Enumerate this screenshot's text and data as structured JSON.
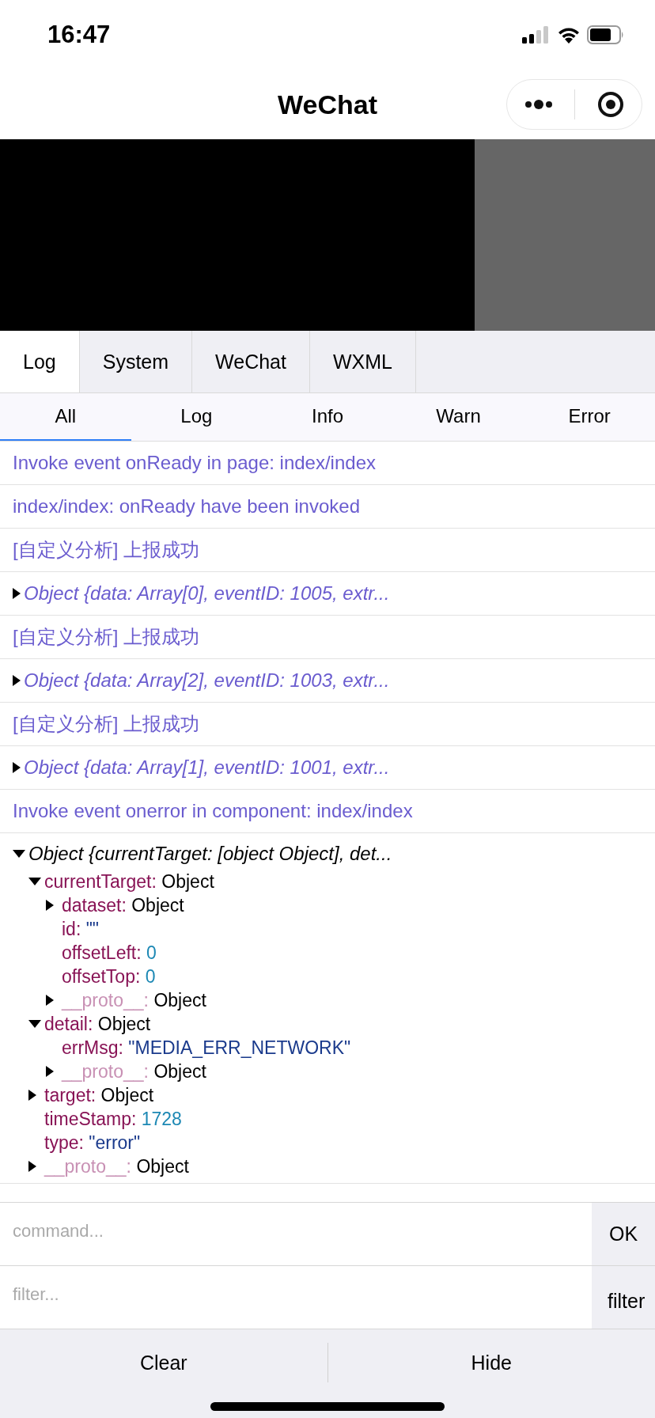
{
  "status_bar": {
    "time": "16:47"
  },
  "nav_bar": {
    "title": "WeChat"
  },
  "tabs": [
    {
      "label": "Log",
      "selected": true
    },
    {
      "label": "System",
      "selected": false
    },
    {
      "label": "WeChat",
      "selected": false
    },
    {
      "label": "WXML",
      "selected": false
    }
  ],
  "filters": [
    {
      "label": "All",
      "selected": true
    },
    {
      "label": "Log",
      "selected": false
    },
    {
      "label": "Info",
      "selected": false
    },
    {
      "label": "Warn",
      "selected": false
    },
    {
      "label": "Error",
      "selected": false
    }
  ],
  "log_entries": [
    {
      "kind": "text",
      "text": "Invoke event onReady in page: index/index"
    },
    {
      "kind": "text",
      "text": "index/index: onReady have been invoked"
    },
    {
      "kind": "text",
      "text": "[自定义分析] 上报成功"
    },
    {
      "kind": "object",
      "expanded": false,
      "text": "Object {data: Array[0], eventID: 1005, extr..."
    },
    {
      "kind": "text",
      "text": "[自定义分析] 上报成功"
    },
    {
      "kind": "object",
      "expanded": false,
      "text": "Object {data: Array[2], eventID: 1003, extr..."
    },
    {
      "kind": "text",
      "text": "[自定义分析] 上报成功"
    },
    {
      "kind": "object",
      "expanded": false,
      "text": "Object {data: Array[1], eventID: 1001, extr..."
    },
    {
      "kind": "text",
      "text": "Invoke event onerror in component: index/index"
    },
    {
      "kind": "object",
      "expanded": true,
      "text": "Object {currentTarget: [object Object], det...",
      "children": [
        {
          "key": "currentTarget:",
          "kind": "object",
          "value": "Object",
          "expanded": true,
          "children": [
            {
              "key": "dataset:",
              "kind": "object",
              "value": "Object",
              "expanded": false
            },
            {
              "key": "id:",
              "kind": "string",
              "value": "\"\""
            },
            {
              "key": "offsetLeft:",
              "kind": "number",
              "value": "0"
            },
            {
              "key": "offsetTop:",
              "kind": "number",
              "value": "0"
            },
            {
              "key": "__proto__:",
              "kind": "proto",
              "value": "Object",
              "expanded": false
            }
          ]
        },
        {
          "key": "detail:",
          "kind": "object",
          "value": "Object",
          "expanded": true,
          "children": [
            {
              "key": "errMsg:",
              "kind": "string",
              "value": "\"MEDIA_ERR_NETWORK\""
            },
            {
              "key": "__proto__:",
              "kind": "proto",
              "value": "Object",
              "expanded": false
            }
          ]
        },
        {
          "key": "target:",
          "kind": "object",
          "value": "Object",
          "expanded": false
        },
        {
          "key": "timeStamp:",
          "kind": "number",
          "value": "1728"
        },
        {
          "key": "type:",
          "kind": "string",
          "value": "\"error\""
        },
        {
          "key": "__proto__:",
          "kind": "proto",
          "value": "Object",
          "expanded": false
        }
      ]
    }
  ],
  "command": {
    "placeholder": "command...",
    "button": "OK"
  },
  "filter": {
    "placeholder": "filter...",
    "button": "filter"
  },
  "bottom_buttons": [
    "Clear",
    "Hide"
  ]
}
